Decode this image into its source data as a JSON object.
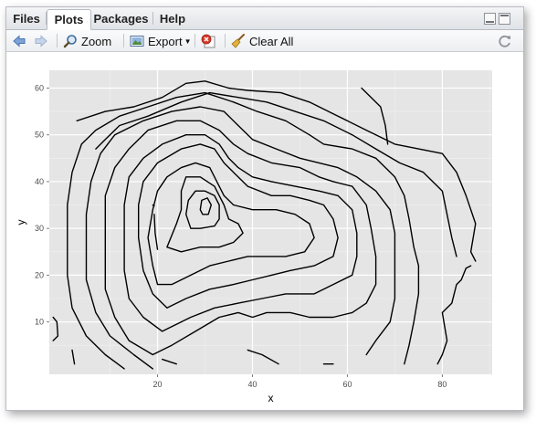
{
  "tabs": [
    {
      "label": "Files",
      "active": false
    },
    {
      "label": "Plots",
      "active": true
    },
    {
      "label": "Packages",
      "active": false
    },
    {
      "label": "Help",
      "active": false
    }
  ],
  "toolbar": {
    "zoom_label": "Zoom",
    "export_label": "Export",
    "clear_label": "Clear All",
    "icons": [
      "back-arrow-icon",
      "forward-arrow-icon",
      "zoom-icon",
      "export-image-icon",
      "remove-plot-icon",
      "broom-icon",
      "refresh-icon"
    ]
  },
  "colors": {
    "panel_bg": "#e5e5e5",
    "grid_major": "#ffffff",
    "grid_minor": "#f2f2f2",
    "contour": "#000000",
    "nav_icon": "#5b87c5"
  },
  "chart_data": {
    "type": "contour",
    "title": "",
    "xlabel": "x",
    "ylabel": "y",
    "xlim": [
      -2.8,
      90.5
    ],
    "ylim": [
      -1.2,
      63.8
    ],
    "xticks": [
      20,
      40,
      60,
      80
    ],
    "yticks": [
      10,
      20,
      30,
      40,
      50,
      60
    ],
    "grid": true,
    "legend": "none",
    "contours": [
      [
        [
          3,
          53
        ],
        [
          9,
          55
        ],
        [
          15,
          56
        ],
        [
          21,
          58
        ],
        [
          26,
          61
        ],
        [
          30,
          61.5
        ],
        [
          35,
          60
        ],
        [
          39,
          59.5
        ],
        [
          46,
          59
        ],
        [
          52,
          57
        ],
        [
          58,
          54
        ],
        [
          64,
          51
        ],
        [
          70,
          48
        ],
        [
          75,
          47
        ],
        [
          80,
          46
        ],
        [
          83,
          42
        ],
        [
          85,
          37
        ],
        [
          87,
          31
        ],
        [
          86,
          25
        ],
        [
          87,
          23
        ]
      ],
      [
        [
          7,
          47
        ],
        [
          9,
          49
        ],
        [
          12,
          52
        ],
        [
          18,
          54
        ],
        [
          25,
          57
        ],
        [
          31,
          59
        ],
        [
          37,
          58
        ],
        [
          43,
          57
        ],
        [
          49,
          55
        ],
        [
          55,
          53
        ],
        [
          61,
          50
        ],
        [
          66,
          47
        ],
        [
          71,
          44
        ],
        [
          76,
          42
        ],
        [
          80,
          38
        ],
        [
          81,
          33
        ],
        [
          82,
          28
        ],
        [
          83,
          24
        ]
      ],
      [
        [
          13,
          0
        ],
        [
          9,
          3
        ],
        [
          5,
          7
        ],
        [
          2,
          13
        ],
        [
          1,
          20
        ],
        [
          1,
          28
        ],
        [
          1,
          35
        ],
        [
          2,
          42
        ],
        [
          4,
          48
        ],
        [
          7,
          51
        ],
        [
          12,
          54
        ],
        [
          18,
          56
        ],
        [
          24,
          58
        ],
        [
          30,
          59
        ],
        [
          36,
          57
        ],
        [
          41,
          55
        ],
        [
          47,
          53
        ],
        [
          52,
          50
        ],
        [
          55,
          48
        ],
        [
          61,
          47
        ],
        [
          66,
          45
        ],
        [
          70,
          41
        ],
        [
          72,
          37
        ],
        [
          73,
          32
        ],
        [
          74,
          26
        ],
        [
          75,
          22
        ],
        [
          75,
          16
        ],
        [
          74,
          10
        ],
        [
          73,
          5
        ],
        [
          72,
          1
        ]
      ],
      [
        [
          19,
          0
        ],
        [
          15,
          3
        ],
        [
          10,
          7
        ],
        [
          7,
          12
        ],
        [
          5,
          19
        ],
        [
          5,
          26
        ],
        [
          5,
          33
        ],
        [
          6,
          40
        ],
        [
          8,
          46
        ],
        [
          11,
          50
        ],
        [
          17,
          53
        ],
        [
          23,
          55
        ],
        [
          29,
          56
        ],
        [
          34,
          55
        ],
        [
          37,
          52
        ],
        [
          40,
          49
        ],
        [
          45,
          47
        ],
        [
          50,
          45
        ],
        [
          54,
          44
        ],
        [
          58,
          43
        ],
        [
          62,
          41
        ],
        [
          66,
          38
        ],
        [
          69,
          34
        ],
        [
          70,
          29
        ],
        [
          70,
          22
        ],
        [
          70,
          15
        ],
        [
          69,
          10
        ],
        [
          66,
          6
        ],
        [
          64,
          3
        ]
      ],
      [
        [
          19,
          3
        ],
        [
          14,
          6
        ],
        [
          11,
          11
        ],
        [
          9,
          17
        ],
        [
          9,
          23
        ],
        [
          9,
          30
        ],
        [
          9,
          37
        ],
        [
          11,
          43
        ],
        [
          14,
          47
        ],
        [
          18,
          51
        ],
        [
          24,
          53
        ],
        [
          29,
          53
        ],
        [
          33,
          51
        ],
        [
          36,
          48
        ],
        [
          39,
          46
        ],
        [
          44,
          44
        ],
        [
          50,
          43
        ],
        [
          54,
          41
        ],
        [
          57,
          40
        ],
        [
          61,
          39
        ],
        [
          64,
          35
        ],
        [
          65,
          30
        ],
        [
          66,
          24
        ],
        [
          66,
          18
        ],
        [
          64,
          14
        ],
        [
          61,
          12
        ],
        [
          57,
          11
        ],
        [
          52,
          11
        ],
        [
          48,
          12
        ],
        [
          43,
          12
        ],
        [
          40,
          11
        ],
        [
          37,
          12
        ],
        [
          33,
          11
        ],
        [
          28,
          8
        ],
        [
          23,
          5
        ],
        [
          19,
          3
        ]
      ],
      [
        [
          21,
          8
        ],
        [
          17,
          11
        ],
        [
          14,
          15
        ],
        [
          13,
          21
        ],
        [
          13,
          28
        ],
        [
          13,
          35
        ],
        [
          14,
          41
        ],
        [
          17,
          45
        ],
        [
          21,
          48
        ],
        [
          26,
          50
        ],
        [
          30,
          50
        ],
        [
          33,
          48
        ],
        [
          35,
          45
        ],
        [
          37,
          43
        ],
        [
          40,
          41
        ],
        [
          44,
          40
        ],
        [
          49,
          39
        ],
        [
          54,
          38
        ],
        [
          58,
          37
        ],
        [
          61,
          34
        ],
        [
          62,
          29
        ],
        [
          62,
          24
        ],
        [
          61,
          20
        ],
        [
          57,
          18
        ],
        [
          53,
          16
        ],
        [
          47,
          16
        ],
        [
          42,
          15
        ],
        [
          37,
          14
        ],
        [
          32,
          13
        ],
        [
          27,
          11
        ],
        [
          23,
          9
        ],
        [
          21,
          8
        ]
      ],
      [
        [
          22,
          13
        ],
        [
          19,
          16
        ],
        [
          17,
          21
        ],
        [
          16,
          28
        ],
        [
          16,
          35
        ],
        [
          17,
          40
        ],
        [
          20,
          44
        ],
        [
          25,
          47
        ],
        [
          29,
          48
        ],
        [
          32,
          47
        ],
        [
          34,
          44
        ],
        [
          36,
          42
        ],
        [
          39,
          39
        ],
        [
          44,
          37
        ],
        [
          48,
          37
        ],
        [
          52,
          36
        ],
        [
          55,
          35
        ],
        [
          57,
          32
        ],
        [
          58,
          28
        ],
        [
          57,
          24
        ],
        [
          53,
          22
        ],
        [
          48,
          21
        ],
        [
          44,
          20
        ],
        [
          40,
          19
        ],
        [
          36,
          18
        ],
        [
          31,
          17
        ],
        [
          26,
          15
        ],
        [
          22,
          13
        ]
      ],
      [
        [
          20,
          18
        ],
        [
          19,
          22
        ],
        [
          18,
          28
        ],
        [
          19,
          34
        ],
        [
          20,
          38
        ],
        [
          22,
          41
        ],
        [
          25,
          43
        ],
        [
          28,
          44
        ],
        [
          31,
          43
        ],
        [
          32,
          41
        ],
        [
          33,
          39
        ],
        [
          34,
          37
        ],
        [
          36,
          35
        ],
        [
          40,
          34
        ],
        [
          45,
          34
        ],
        [
          49,
          33
        ],
        [
          52,
          31
        ],
        [
          53,
          28
        ],
        [
          51,
          25
        ],
        [
          47,
          24
        ],
        [
          43,
          24
        ],
        [
          39,
          24
        ],
        [
          35,
          23
        ],
        [
          31,
          22
        ],
        [
          27,
          20
        ],
        [
          23,
          18
        ],
        [
          20,
          18
        ]
      ],
      [
        [
          22,
          26
        ],
        [
          24,
          31
        ],
        [
          25,
          34
        ],
        [
          25,
          38
        ],
        [
          26,
          41
        ],
        [
          29,
          41
        ],
        [
          32,
          39
        ],
        [
          33,
          37
        ],
        [
          34,
          35
        ],
        [
          35,
          32
        ],
        [
          37,
          31
        ],
        [
          38,
          29
        ],
        [
          36,
          27
        ],
        [
          33,
          26
        ],
        [
          29,
          26
        ],
        [
          25,
          25
        ],
        [
          22,
          26
        ]
      ],
      [
        [
          27,
          30
        ],
        [
          26,
          33
        ],
        [
          26.5,
          36
        ],
        [
          28,
          38
        ],
        [
          30,
          38
        ],
        [
          32,
          37
        ],
        [
          33,
          35
        ],
        [
          33,
          32
        ],
        [
          32,
          30.5
        ],
        [
          29,
          30
        ],
        [
          27,
          30
        ]
      ],
      [
        [
          29,
          34
        ],
        [
          29.3,
          36
        ],
        [
          30.5,
          36.5
        ],
        [
          31.3,
          35
        ],
        [
          30.7,
          33
        ],
        [
          29.5,
          33
        ],
        [
          29,
          34
        ]
      ],
      [
        [
          19,
          35
        ],
        [
          19.3,
          34.8
        ]
      ],
      [
        [
          19.3,
          33
        ],
        [
          19.5,
          29
        ],
        [
          20,
          25.5
        ]
      ],
      [
        [
          63,
          60
        ],
        [
          67,
          56
        ],
        [
          68,
          52
        ],
        [
          68.5,
          48
        ]
      ],
      [
        [
          86,
          22
        ],
        [
          85,
          21.5
        ],
        [
          84,
          19
        ],
        [
          83,
          18
        ],
        [
          82,
          14
        ],
        [
          80,
          12
        ],
        [
          81,
          6
        ],
        [
          80,
          3
        ],
        [
          79,
          1
        ]
      ],
      [
        [
          -2,
          11
        ],
        [
          -1.2,
          10
        ],
        [
          -1,
          7
        ],
        [
          -2,
          6
        ]
      ],
      [
        [
          39,
          4
        ],
        [
          42,
          3
        ],
        [
          45.5,
          1
        ]
      ],
      [
        [
          55,
          1
        ],
        [
          57,
          1
        ]
      ],
      [
        [
          2,
          4
        ],
        [
          2.5,
          1
        ]
      ],
      [
        [
          21,
          2
        ],
        [
          24,
          1
        ]
      ]
    ]
  }
}
